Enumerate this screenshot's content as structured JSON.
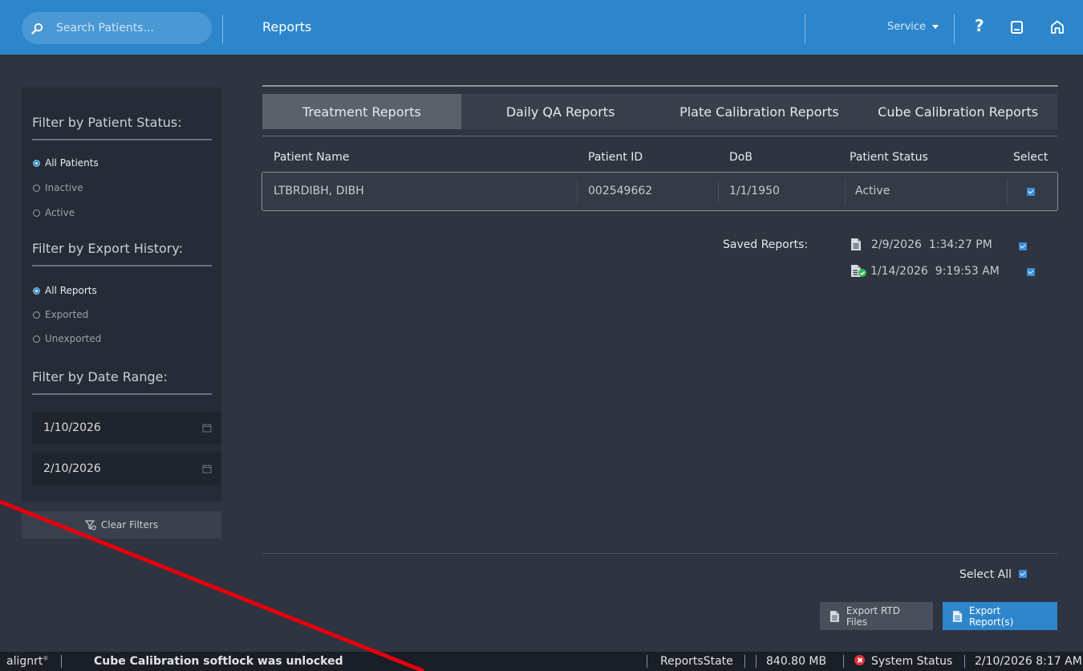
{
  "header": {
    "search_placeholder": "Search Patients...",
    "page_title": "Reports",
    "service_label": "Service",
    "help_label": "?"
  },
  "sidebar": {
    "patient_status_title": "Filter by Patient Status:",
    "patient_status_options": [
      "All Patients",
      "Inactive",
      "Active"
    ],
    "patient_status_selected": "All Patients",
    "export_history_title": "Filter by Export History:",
    "export_history_options": [
      "All Reports",
      "Exported",
      "Unexported"
    ],
    "export_history_selected": "All Reports",
    "date_range_title": "Filter by Date Range:",
    "date_from": "1/10/2026",
    "date_to": "2/10/2026",
    "clear_filters_label": "Clear Filters"
  },
  "tabs": [
    "Treatment Reports",
    "Daily QA Reports",
    "Plate Calibration Reports",
    "Cube Calibration Reports"
  ],
  "active_tab": "Treatment Reports",
  "table": {
    "columns": [
      "Patient Name",
      "Patient ID",
      "DoB",
      "Patient Status",
      "Select"
    ],
    "rows": [
      {
        "name": "LTBRDIBH, DIBH",
        "id": "002549662",
        "dob": "1/1/1950",
        "status": "Active",
        "selected": true
      }
    ]
  },
  "saved_reports": {
    "label": "Saved Reports:",
    "items": [
      {
        "date": "2/9/2026",
        "time": "1:34:27 PM",
        "exported": false,
        "selected": true
      },
      {
        "date": "1/14/2026",
        "time": "9:19:53 AM",
        "exported": true,
        "selected": true
      }
    ]
  },
  "footer": {
    "select_all_label": "Select All",
    "select_all_checked": true,
    "export_rtd_label": "Export RTD Files",
    "export_reports_label": "Export Report(s)"
  },
  "statusbar": {
    "brand": "alignrt",
    "brand_mark": "®",
    "message": "Cube Calibration softlock was unlocked",
    "state": "ReportsState",
    "memory": "840.80 MB",
    "system_status": "System Status",
    "datetime": "2/10/2026 8:17 AM"
  },
  "colors": {
    "header_bg": "#2d86cb",
    "body_bg": "#2e3440",
    "accent": "#2d86cb",
    "annotation_line": "#e3000f",
    "error": "#e0323c"
  }
}
